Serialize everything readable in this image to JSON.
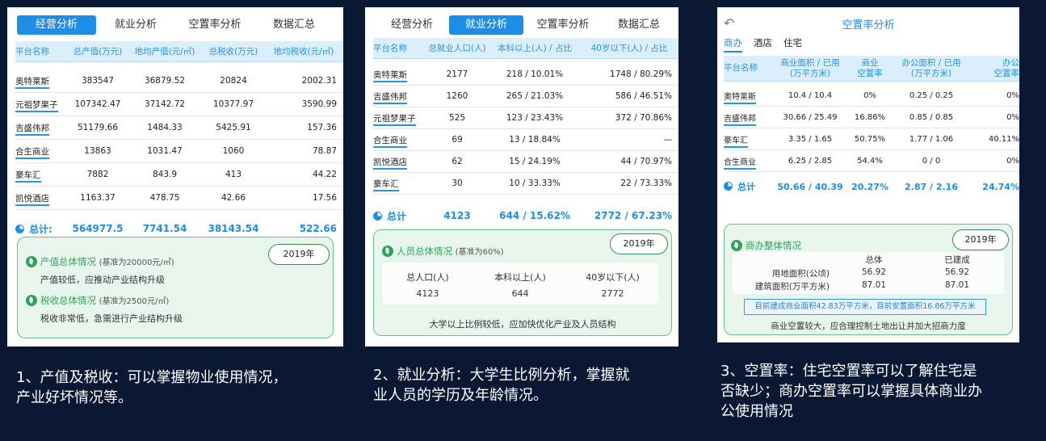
{
  "panel1": {
    "tabs": [
      "经营分析",
      "就业分析",
      "空置率分析",
      "数据汇总"
    ],
    "active_tab": 0,
    "headers": [
      "平台名称",
      "总产值(万元)",
      "地均产值(元/㎡)",
      "总税收(万元)",
      "地均税收(元/㎡)"
    ],
    "rows": [
      [
        "奥特莱斯",
        "383547",
        "36879.52",
        "20824",
        "2002.31"
      ],
      [
        "元祖梦果子",
        "107342.47",
        "37142.72",
        "10377.97",
        "3590.99"
      ],
      [
        "吉盛伟邦",
        "51179.66",
        "1484.33",
        "5425.91",
        "157.36"
      ],
      [
        "合生商业",
        "13863",
        "1031.47",
        "1060",
        "78.87"
      ],
      [
        "豪车汇",
        "7882",
        "843.9",
        "413",
        "44.22"
      ],
      [
        "凯悦酒店",
        "1163.37",
        "478.75",
        "42.66",
        "17.56"
      ]
    ],
    "total": [
      "总计:",
      "564977.5",
      "7741.54",
      "38143.54",
      "522.66"
    ],
    "year": "2019年",
    "sec1_title": "产值总体情况",
    "sec1_hint": "(基准为20000元/㎡)",
    "sec1_text": "产值较低，应推动产业结构升级",
    "sec2_title": "税收总体情况",
    "sec2_hint": "(基准为2500元/㎡)",
    "sec2_text": "税收非常低，急需进行产业结构升级"
  },
  "panel2": {
    "tabs": [
      "经营分析",
      "就业分析",
      "空置率分析",
      "数据汇总"
    ],
    "active_tab": 1,
    "headers": [
      "平台名称",
      "总就业人口(人)",
      "本科以上(人) / 占比",
      "40岁以下(人) / 占比"
    ],
    "rows": [
      [
        "奥特莱斯",
        "2177",
        "218 / 10.01%",
        "1748 / 80.29%"
      ],
      [
        "吉盛伟邦",
        "1260",
        "265 / 21.03%",
        "586 / 46.51%"
      ],
      [
        "元祖梦果子",
        "525",
        "123 / 23.43%",
        "372 / 70.86%"
      ],
      [
        "合生商业",
        "69",
        "13 / 18.84%",
        "—"
      ],
      [
        "凯悦酒店",
        "62",
        "15 / 24.19%",
        "44 / 70.97%"
      ],
      [
        "豪车汇",
        "30",
        "10 / 33.33%",
        "22 / 73.33%"
      ]
    ],
    "total": [
      "总计",
      "4123",
      "644 / 15.62%",
      "2772 / 67.23%"
    ],
    "year": "2019年",
    "sec_title": "人员总体情况",
    "sec_hint": "(基准为60%)",
    "stat_headers": [
      "总人口(人)",
      "本科以上(人)",
      "40岁以下(人)"
    ],
    "stat_values": [
      "4123",
      "644",
      "2772"
    ],
    "note": "大学以上比例较低，应加快优化产业及人员结构"
  },
  "panel3": {
    "title": "空置率分析",
    "back_icon": "back-arrow-icon",
    "subtabs": [
      "商办",
      "酒店",
      "住宅"
    ],
    "active_subtab": 0,
    "headers": [
      [
        "平台名称",
        ""
      ],
      [
        "商业面积 / 已用",
        "(万平方米)"
      ],
      [
        "商业",
        "空置率"
      ],
      [
        "办公面积 / 已用",
        "(万平方米)"
      ],
      [
        "办公",
        "空置率"
      ]
    ],
    "rows": [
      [
        "奥特莱斯",
        "10.4 / 10.4",
        "0%",
        "0.25 / 0.25",
        "0%"
      ],
      [
        "吉盛伟邦",
        "30.66 / 25.49",
        "16.86%",
        "0.85 / 0.85",
        "0%"
      ],
      [
        "豪车汇",
        "3.35 / 1.65",
        "50.75%",
        "1.77 / 1.06",
        "40.11%"
      ],
      [
        "合生商业",
        "6.25 / 2.85",
        "54.4%",
        "0 / 0",
        "0%"
      ]
    ],
    "total": [
      "总计",
      "50.66 / 40.39",
      "20.27%",
      "2.87 / 2.16",
      "24.74%"
    ],
    "year": "2019年",
    "sec_title": "商办整体情况",
    "stat_headers": [
      "",
      "总体",
      "已建成"
    ],
    "stat_rows": [
      [
        "用地面积(公顷)",
        "56.92",
        "56.92"
      ],
      [
        "建筑面积(万平方米)",
        "87.01",
        "87.01"
      ]
    ],
    "highlight": "目前建成商业面积42.83万平方米，目前安置面积16.86万平方米",
    "note": "商业空置较大，应合理控制土地出让并加大招商力度"
  },
  "captions": [
    [
      "1、产值及税收：可以掌握物业使用情况，",
      "产业好坏情况等。"
    ],
    [
      "2、就业分析：大学生比例分析，掌握就",
      "业人员的学历及年龄情况。"
    ],
    [
      "3、空置率：住宅空置率可以了解住宅是",
      "否缺少；商办空置率可以掌握具体商业办",
      "公使用情况"
    ]
  ]
}
